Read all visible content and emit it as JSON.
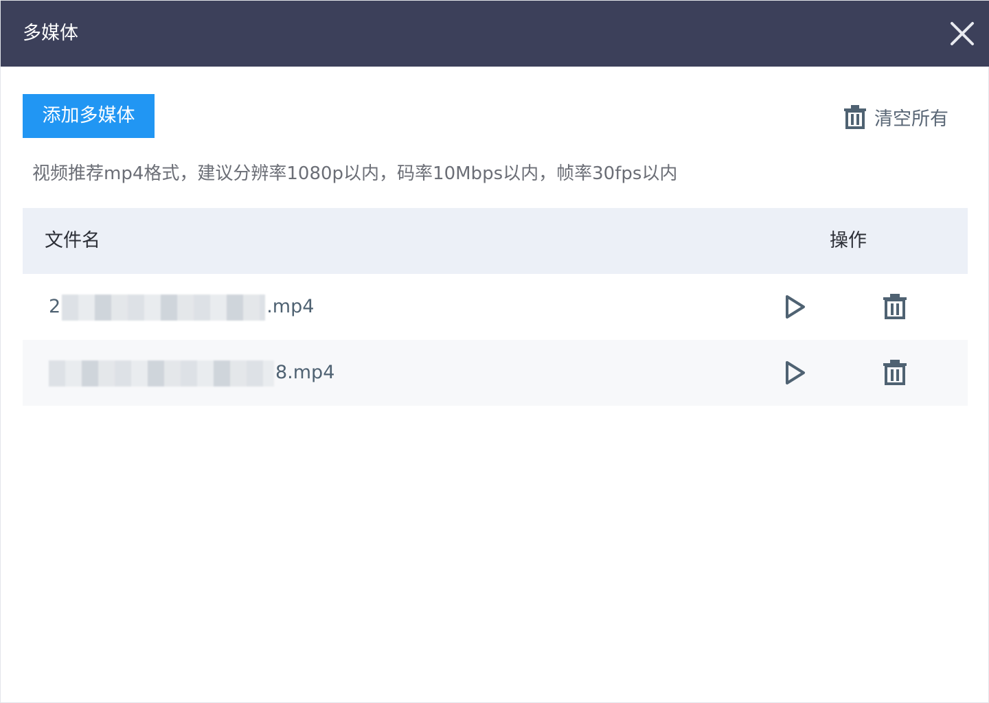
{
  "dialog": {
    "title": "多媒体"
  },
  "toolbar": {
    "add_label": "添加多媒体",
    "clear_all_label": "清空所有"
  },
  "hint": "视频推荐mp4格式，建议分辨率1080p以内，码率10Mbps以内，帧率30fps以内",
  "table": {
    "columns": [
      "文件名",
      "操作"
    ],
    "rows": [
      {
        "name_prefix": "2",
        "name_suffix": ".mp4"
      },
      {
        "name_prefix": "",
        "name_suffix": "8.mp4"
      }
    ]
  },
  "colors": {
    "titlebar": "#3c405a",
    "accent": "#2196f3",
    "icon": "#4f6272",
    "header_bg": "#ecf0f7"
  },
  "icons": {
    "close": "close-icon",
    "trash": "trash-icon",
    "play": "play-icon"
  }
}
